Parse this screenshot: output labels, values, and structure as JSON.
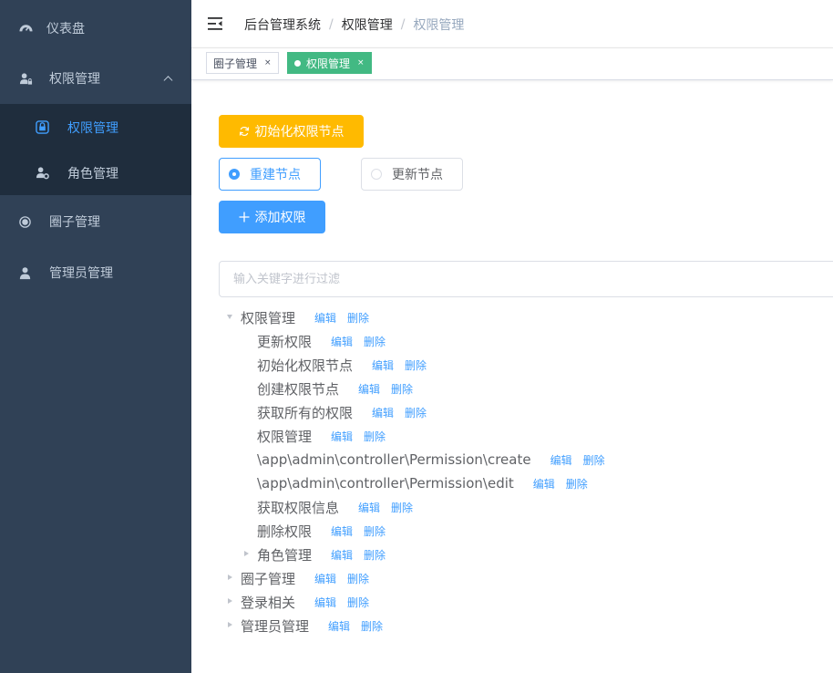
{
  "sidebar": {
    "items": [
      {
        "label": "仪表盘",
        "icon": "dashboard-icon"
      },
      {
        "label": "权限管理",
        "icon": "user-lock-icon"
      },
      {
        "label": "权限管理",
        "icon": "lock-icon"
      },
      {
        "label": "角色管理",
        "icon": "user-gear-icon"
      },
      {
        "label": "圈子管理",
        "icon": "circle-dot-icon"
      },
      {
        "label": "管理员管理",
        "icon": "user-icon"
      }
    ]
  },
  "header": {
    "breadcrumb": [
      "后台管理系统",
      "权限管理",
      "权限管理"
    ]
  },
  "tags": [
    {
      "label": "圈子管理",
      "close": "×"
    },
    {
      "label": "权限管理",
      "close": "×"
    }
  ],
  "actions": {
    "init_label": "初始化权限节点",
    "rebuild_label": "重建节点",
    "update_label": "更新节点",
    "add_label": "添加权限"
  },
  "filter": {
    "placeholder": "输入关键字进行过滤",
    "value": ""
  },
  "tree": {
    "edit_label": "编辑",
    "delete_label": "删除",
    "nodes": [
      {
        "label": "权限管理"
      },
      {
        "label": "更新权限"
      },
      {
        "label": "初始化权限节点"
      },
      {
        "label": "创建权限节点"
      },
      {
        "label": "获取所有的权限"
      },
      {
        "label": "权限管理"
      },
      {
        "label": "\\app\\admin\\controller\\Permission\\create"
      },
      {
        "label": "\\app\\admin\\controller\\Permission\\edit"
      },
      {
        "label": "获取权限信息"
      },
      {
        "label": "删除权限"
      },
      {
        "label": "角色管理"
      },
      {
        "label": "圈子管理"
      },
      {
        "label": "登录相关"
      },
      {
        "label": "管理员管理"
      }
    ]
  },
  "colors": {
    "sidebar_bg": "#304156",
    "submenu_bg": "#1f2d3d",
    "accent": "#409eff",
    "warning": "#ffba00",
    "tag_active": "#42b983"
  }
}
